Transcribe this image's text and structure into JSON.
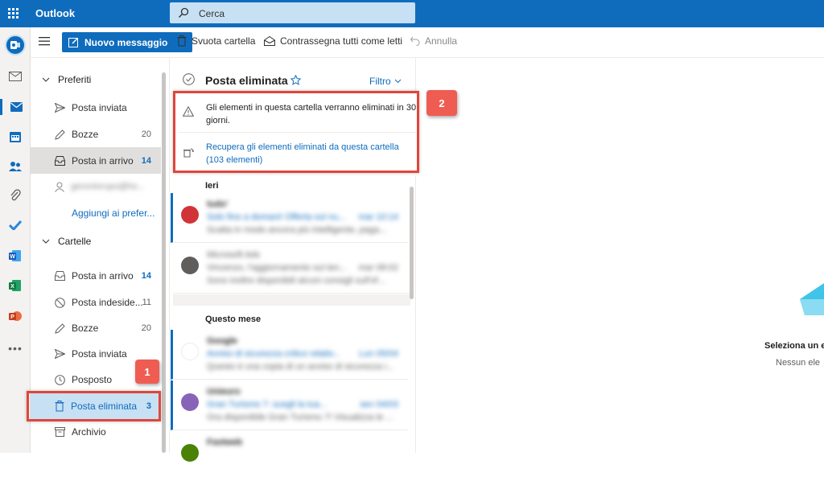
{
  "topbar": {
    "app_name": "Outlook",
    "search_placeholder": "Cerca"
  },
  "toolbar": {
    "new_message": "Nuovo messaggio",
    "empty_folder": "Svuota cartella",
    "mark_all_read": "Contrassegna tutti come letti",
    "undo": "Annulla"
  },
  "favorites": {
    "header": "Preferiti",
    "items": [
      {
        "label": "Posta inviata",
        "count": ""
      },
      {
        "label": "Bozze",
        "count": "20"
      },
      {
        "label": "Posta in arrivo",
        "count": "14"
      },
      {
        "label": "gerontorupo@ho...",
        "count": ""
      }
    ],
    "add_link": "Aggiungi ai prefer..."
  },
  "folders": {
    "header": "Cartelle",
    "items": [
      {
        "label": "Posta in arrivo",
        "count": "14"
      },
      {
        "label": "Posta indeside...",
        "count": "11"
      },
      {
        "label": "Bozze",
        "count": "20"
      },
      {
        "label": "Posta inviata",
        "count": ""
      },
      {
        "label": "Posposto",
        "count": ""
      },
      {
        "label": "Posta eliminata",
        "count": "3"
      },
      {
        "label": "Archivio",
        "count": ""
      }
    ]
  },
  "list": {
    "title": "Posta eliminata",
    "filter": "Filtro",
    "banner_warning": "Gli elementi in questa cartella verranno eliminati in 30 giorni.",
    "banner_recover": "Recupera gli elementi eliminati da questa cartella (103 elementi)",
    "group_yesterday": "Ieri",
    "group_month": "Questo mese",
    "messages": [
      {
        "sender": "tudo'",
        "subject": "Solo fino a domani! Offerta sul nu...",
        "time": "mar 10:14",
        "preview": "Scatta in modo ancora più intelligente, paga...",
        "avatar_text": "t",
        "avatar_color": "#d13438"
      },
      {
        "sender": "Microsoft Ads",
        "subject": "Vincenzo, l'aggiornamento sul ten...",
        "time": "mar 08:02",
        "preview": "Sono inoltre disponibili alcuni consigli sull'of...",
        "avatar_text": "MA",
        "avatar_color": "#605e5c"
      },
      {
        "sender": "Google",
        "subject": "Avviso di sicurezza critico relativ...",
        "time": "Lun 05/04",
        "preview": "Questo è una copia di un avviso di sicurezza i...",
        "avatar_text": "G",
        "avatar_color": "#ffffff"
      },
      {
        "sender": "Unieuro",
        "subject": "Gran Turismo 7: scegli la tua...",
        "time": "sev 04/03",
        "preview": "Ora disponibile Gran Turismo 7! Visualizza le ...",
        "avatar_text": "U",
        "avatar_color": "#8764b8"
      },
      {
        "sender": "Fastweb",
        "subject": "",
        "time": "",
        "preview": "",
        "avatar_text": "F",
        "avatar_color": "#498205"
      }
    ]
  },
  "reading": {
    "title": "Seleziona un e",
    "subtitle": "Nessun ele"
  },
  "callouts": {
    "one": "1",
    "two": "2"
  }
}
